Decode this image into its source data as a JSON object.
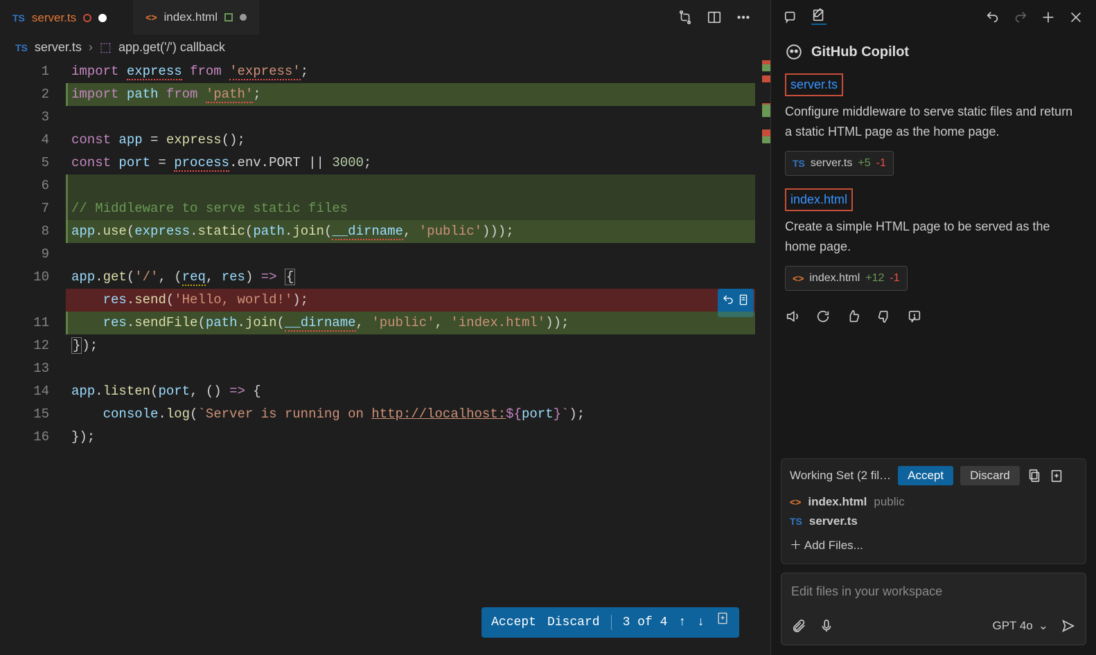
{
  "tabs": [
    {
      "icon": "TS",
      "label": "server.ts",
      "modified": true
    },
    {
      "icon": "<>",
      "label": "index.html",
      "modified": true
    }
  ],
  "breadcrumb": {
    "icon": "TS",
    "file": "server.ts",
    "symbol": "app.get('/') callback"
  },
  "code": {
    "lines": [
      "1",
      "2",
      "3",
      "4",
      "5",
      "6",
      "7",
      "8",
      "9",
      "10",
      "",
      "11",
      "12",
      "13",
      "14",
      "15",
      "16"
    ]
  },
  "code_lines": {
    "l1a": "import",
    "l1b": "express",
    "l1c": "from",
    "l1d": "'express'",
    "l1e": ";",
    "l2a": "import",
    "l2b": "path",
    "l2c": "from",
    "l2d": "'path'",
    "l2e": ";",
    "l4a": "const",
    "l4b": "app",
    "l4c": " = ",
    "l4d": "express",
    "l4e": "();",
    "l5a": "const",
    "l5b": "port",
    "l5c": " = ",
    "l5d": "process",
    "l5e": ".env.PORT || ",
    "l5f": "3000",
    "l5g": ";",
    "l7": "// Middleware to serve static files",
    "l8a": "app",
    "l8b": ".",
    "l8c": "use",
    "l8d": "(",
    "l8e": "express",
    "l8f": ".",
    "l8g": "static",
    "l8h": "(",
    "l8i": "path",
    "l8j": ".",
    "l8k": "join",
    "l8l": "(",
    "l8m": "__dirname",
    "l8n": ", ",
    "l8o": "'public'",
    "l8p": ")));",
    "l10a": "app",
    "l10b": ".",
    "l10c": "get",
    "l10d": "(",
    "l10e": "'/'",
    "l10f": ", (",
    "l10g": "req",
    "l10h": ", ",
    "l10i": "res",
    "l10j": ") ",
    "l10k": "=>",
    "l10l": " ",
    "l10m": "{",
    "l11aa": "    ",
    "l11a": "res",
    "l11b": ".",
    "l11c": "send",
    "l11d": "(",
    "l11e": "'Hello, world!'",
    "l11f": ");",
    "l11xa": "    ",
    "l11x": "res",
    "l11y": ".",
    "l11z": "sendFile",
    "l11p": "(",
    "l11q": "path",
    "l11r": ".",
    "l11s": "join",
    "l11t": "(",
    "l11u": "__dirname",
    "l11v": ", ",
    "l11w": "'public'",
    "l11w2": ", ",
    "l11w3": "'index.html'",
    "l11w4": "));",
    "l12a": "}",
    "l12b": ");",
    "l14a": "app",
    "l14b": ".",
    "l14c": "listen",
    "l14d": "(",
    "l14e": "port",
    "l14f": ", () ",
    "l14g": "=>",
    "l14h": " {",
    "l15a": "    console",
    "l15b": ".",
    "l15c": "log",
    "l15d": "(",
    "l15e": "`Server is running on ",
    "l15f": "http://localhost:",
    "l15g": "${",
    "l15h": "port",
    "l15i": "}",
    "l15j": "`",
    "l15k": ");",
    "l16": "});"
  },
  "bottom": {
    "accept": "Accept",
    "discard": "Discard",
    "status": "3 of 4"
  },
  "copilot": {
    "title": "GitHub Copilot",
    "items": [
      {
        "file": "server.ts",
        "desc": "Configure middleware to serve static files and return a static HTML page as the home page.",
        "badge_icon": "TS",
        "badge_name": "server.ts",
        "add": "+5",
        "del": "-1"
      },
      {
        "file": "index.html",
        "desc": "Create a simple HTML page to be served as the home page.",
        "badge_icon": "<>",
        "badge_name": "index.html",
        "add": "+12",
        "del": "-1"
      }
    ],
    "workingSet": {
      "title": "Working Set (2 fil…",
      "accept": "Accept",
      "discard": "Discard",
      "files": [
        {
          "icon": "<>",
          "name": "index.html",
          "path": "public"
        },
        {
          "icon": "TS",
          "name": "server.ts",
          "path": ""
        }
      ],
      "addFiles": "Add Files..."
    },
    "input": {
      "placeholder": "Edit files in your workspace",
      "model": "GPT 4o"
    }
  }
}
